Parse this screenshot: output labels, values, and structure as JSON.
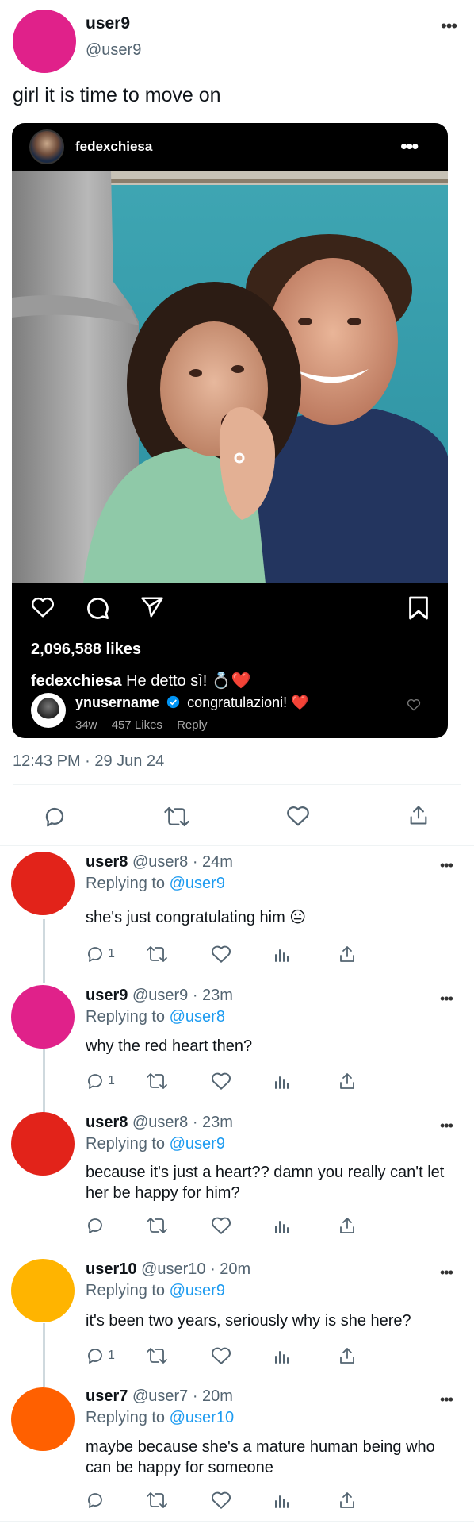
{
  "tweet": {
    "author_name": "user9",
    "author_handle": "@user9",
    "text": "girl it is time to move on",
    "timestamp": "12:43 PM · 29 Jun 24",
    "avatar_color": "#e0218a"
  },
  "instagram": {
    "username": "fedexchiesa",
    "likes": "2,096,588 likes",
    "caption_user": "fedexchiesa",
    "caption_text": "He detto sì! 💍❤️",
    "comment": {
      "user": "ynusername",
      "text": "congratulazioni! ❤️",
      "age": "34w",
      "likes": "457 Likes",
      "reply_label": "Reply"
    }
  },
  "replies": [
    {
      "name": "user8",
      "handle_time": "@user8 · 24m",
      "replying_label": "Replying to",
      "replying_to": "@user9",
      "text": "she's just congratulating him 😐",
      "reply_count": "1",
      "avatar_color": "#e2231a"
    },
    {
      "name": "user9",
      "handle_time": "@user9 · 23m",
      "replying_label": "Replying to",
      "replying_to": "@user8",
      "text": "why the red heart then?",
      "reply_count": "1",
      "avatar_color": "#e0218a"
    },
    {
      "name": "user8",
      "handle_time": "@user8 · 23m",
      "replying_label": "Replying to",
      "replying_to": "@user9",
      "text": "because it's just a heart?? damn you really can't let her be happy for him?",
      "reply_count": "",
      "avatar_color": "#e2231a"
    },
    {
      "name": "user10",
      "handle_time": "@user10 · 20m",
      "replying_label": "Replying to",
      "replying_to": "@user9",
      "text": "it's been two years, seriously why is she here?",
      "reply_count": "1",
      "avatar_color": "#ffb400"
    },
    {
      "name": "user7",
      "handle_time": "@user7 · 20m",
      "replying_label": "Replying to",
      "replying_to": "@user10",
      "text": "maybe because she's a mature human being who can be happy for someone",
      "reply_count": "",
      "avatar_color": "#ff6000"
    }
  ],
  "icons": {
    "reply": "speech-bubble-icon",
    "retweet": "retweet-icon",
    "like": "heart-icon",
    "views": "bar-chart-icon",
    "share": "share-upload-icon",
    "more": "more-dots-icon"
  },
  "colors": {
    "link": "#1d9bf0",
    "secondary_text": "#536471",
    "verified": "#0095f6",
    "heart_red": "#ed1c24"
  }
}
